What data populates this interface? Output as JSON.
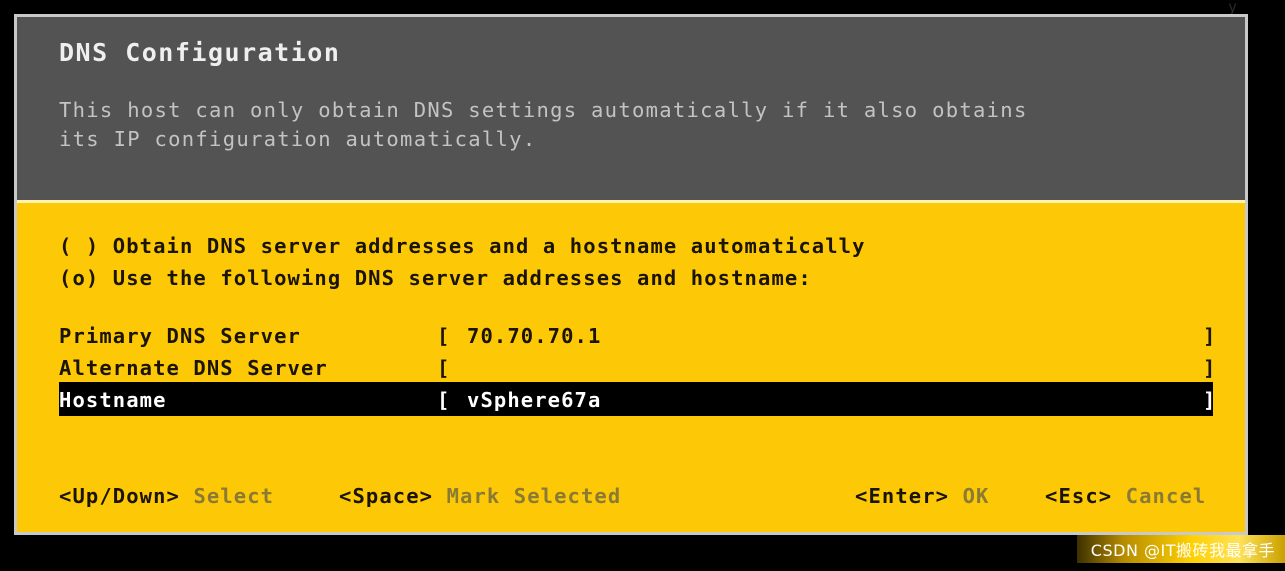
{
  "dialog": {
    "title": "DNS Configuration",
    "description_line1": "This host can only obtain DNS settings automatically if it also obtains",
    "description_line2": "its IP configuration automatically."
  },
  "options": [
    {
      "marker": "( )",
      "label": "Obtain DNS server addresses and a hostname automatically",
      "selected": false
    },
    {
      "marker": "(o)",
      "label": "Use the following DNS server addresses and hostname:",
      "selected": true
    }
  ],
  "fields": [
    {
      "label": "Primary DNS Server",
      "bracket_open": "[",
      "value": "70.70.70.1",
      "bracket_close": "]",
      "highlighted": false
    },
    {
      "label": "Alternate DNS Server",
      "bracket_open": "[",
      "value": "",
      "bracket_close": "]",
      "highlighted": false
    },
    {
      "label": "Hostname",
      "bracket_open": "[",
      "value": "vSphere67a",
      "bracket_close": "]",
      "highlighted": true
    }
  ],
  "footer": [
    {
      "key": "<Up/Down>",
      "action": "Select"
    },
    {
      "key": "<Space>",
      "action": "Mark Selected"
    },
    {
      "key": "<Enter>",
      "action": "OK"
    },
    {
      "key": "<Esc>",
      "action": "Cancel"
    }
  ],
  "watermark": "CSDN @IT搬砖我最拿手",
  "colors": {
    "body_yellow": "#fdc907",
    "header_gray": "#535353",
    "border_gray": "#c9c9c9",
    "highlight_black": "#000000"
  }
}
